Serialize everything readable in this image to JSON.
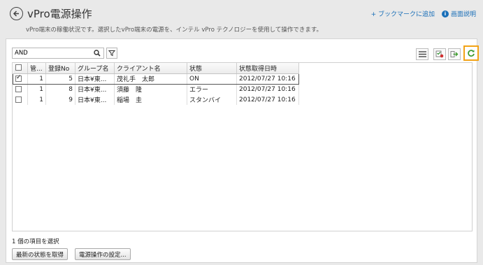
{
  "header": {
    "title": "vPro電源操作",
    "subtitle": "vPro端末の稼働状況です。選択したvPro端末の電源を、インテル vPro テクノロジーを使用して操作できます。",
    "bookmark_link": "+ ブックマークに追加",
    "help_link": "画面説明"
  },
  "search": {
    "value": "AND",
    "placeholder": ""
  },
  "table": {
    "columns": [
      "",
      "管...",
      "登録No",
      "グループ名",
      "クライアント名",
      "状態",
      "状態取得日時"
    ],
    "rows": [
      {
        "checked": true,
        "kan": "1",
        "reg_no": "5",
        "group": "日本¥東...",
        "client": "茂礼手　太郎",
        "status": "ON",
        "datetime": "2012/07/27 10:16"
      },
      {
        "checked": false,
        "kan": "1",
        "reg_no": "8",
        "group": "日本¥東...",
        "client": "須藤　隆",
        "status": "エラー",
        "datetime": "2012/07/27 10:16"
      },
      {
        "checked": false,
        "kan": "1",
        "reg_no": "9",
        "group": "日本¥東...",
        "client": "稲場　圭",
        "status": "スタンバイ",
        "datetime": "2012/07/27 10:16"
      }
    ]
  },
  "footer": {
    "selection_text": "1 個の項目を選択",
    "refresh_status_button": "最新の状態を取得",
    "power_settings_button": "電源操作の設定..."
  },
  "colors": {
    "accent_link": "#1a6fb8",
    "highlight_border": "#f2a316"
  }
}
